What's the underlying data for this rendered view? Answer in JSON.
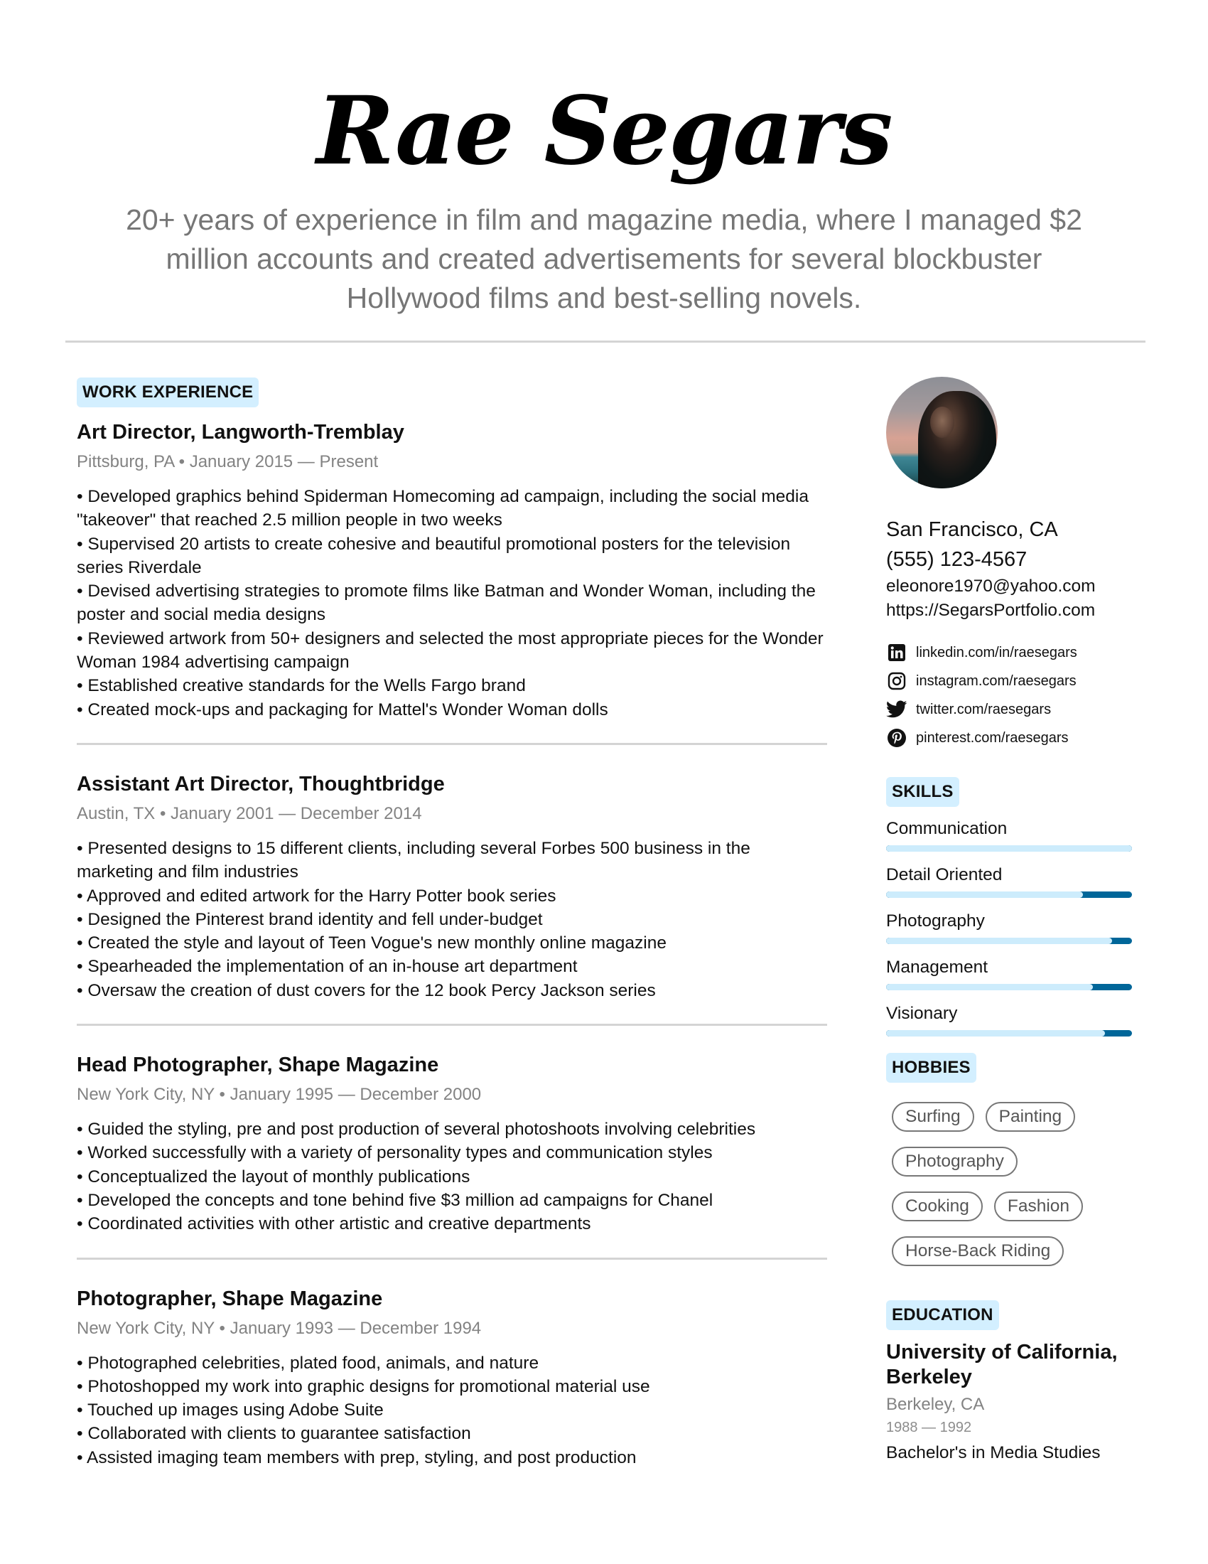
{
  "header": {
    "name": "Rae Segars",
    "summary": "20+ years of experience in film and magazine media, where I managed $2 million accounts and created advertisements for several blockbuster Hollywood films and best-selling novels."
  },
  "work": {
    "section_title": "WORK EXPERIENCE",
    "jobs": [
      {
        "title": "Art Director, Langworth-Tremblay",
        "meta": "Pittsburg, PA • January 2015 — Present",
        "bullets": [
          "• Developed graphics behind Spiderman Homecoming ad campaign, including the social media \"takeover\" that reached 2.5 million people in two weeks",
          "• Supervised 20 artists to create cohesive and beautiful promotional posters for the television series Riverdale",
          "• Devised advertising strategies to promote films like Batman and Wonder Woman, including the poster and social media designs",
          "• Reviewed artwork from 50+ designers and selected the most appropriate pieces for the Wonder Woman 1984 advertising campaign",
          "• Established creative standards for the Wells Fargo brand",
          "• Created mock-ups and packaging for Mattel's Wonder Woman dolls"
        ]
      },
      {
        "title": "Assistant Art Director, Thoughtbridge",
        "meta": "Austin, TX • January 2001 — December 2014",
        "bullets": [
          "• Presented designs to 15 different clients, including several Forbes 500 business in the marketing and film industries",
          "• Approved and edited artwork for the Harry Potter book series",
          "• Designed the Pinterest brand identity and fell under-budget",
          "• Created the style and layout of Teen Vogue's new monthly online magazine",
          "• Spearheaded the implementation of an in-house art department",
          "• Oversaw the creation of dust covers for the 12 book Percy Jackson series"
        ]
      },
      {
        "title": "Head Photographer, Shape Magazine",
        "meta": "New York City, NY • January 1995 — December 2000",
        "bullets": [
          "• Guided the styling, pre and post production of several photoshoots involving celebrities",
          "• Worked successfully with a variety of personality types and communication styles",
          "• Conceptualized the layout of monthly publications",
          "• Developed the concepts and tone behind five $3 million ad campaigns for Chanel",
          "• Coordinated activities with other artistic and creative departments"
        ]
      },
      {
        "title": "Photographer, Shape Magazine",
        "meta": "New York City, NY • January 1993 — December 1994",
        "bullets": [
          "• Photographed celebrities, plated food, animals, and nature",
          "• Photoshopped my work into graphic designs for promotional material use",
          "• Touched up images using Adobe Suite",
          "• Collaborated with clients to guarantee satisfaction",
          "• Assisted imaging team members with prep, styling, and post production"
        ]
      }
    ]
  },
  "contact": {
    "city": "San Francisco, CA",
    "phone": "(555) 123-4567",
    "email": "eleonore1970@yahoo.com",
    "website": "https://SegarsPortfolio.com",
    "socials": [
      {
        "icon": "linkedin-icon",
        "label": "linkedin.com/in/raesegars"
      },
      {
        "icon": "instagram-icon",
        "label": "instagram.com/raesegars"
      },
      {
        "icon": "twitter-icon",
        "label": "twitter.com/raesegars"
      },
      {
        "icon": "pinterest-icon",
        "label": "pinterest.com/raesegars"
      }
    ]
  },
  "skills": {
    "section_title": "SKILLS",
    "items": [
      {
        "label": "Communication",
        "level_pct": 100
      },
      {
        "label": "Detail Oriented",
        "level_pct": 80
      },
      {
        "label": "Photography",
        "level_pct": 92
      },
      {
        "label": "Management",
        "level_pct": 84
      },
      {
        "label": "Visionary",
        "level_pct": 89
      }
    ]
  },
  "hobbies": {
    "section_title": "HOBBIES",
    "items": [
      "Surfing",
      "Painting",
      "Photography",
      "Cooking",
      "Fashion",
      "Horse-Back Riding"
    ]
  },
  "education": {
    "section_title": "EDUCATION",
    "school": "University of California, Berkeley",
    "location": "Berkeley, CA",
    "dates": "1988 — 1992",
    "degree": "Bachelor's in Media Studies"
  },
  "colors": {
    "badge_bg": "#d3efff",
    "skill_dark": "#006699",
    "skill_light": "#cdecfc",
    "muted_text": "#838383"
  }
}
